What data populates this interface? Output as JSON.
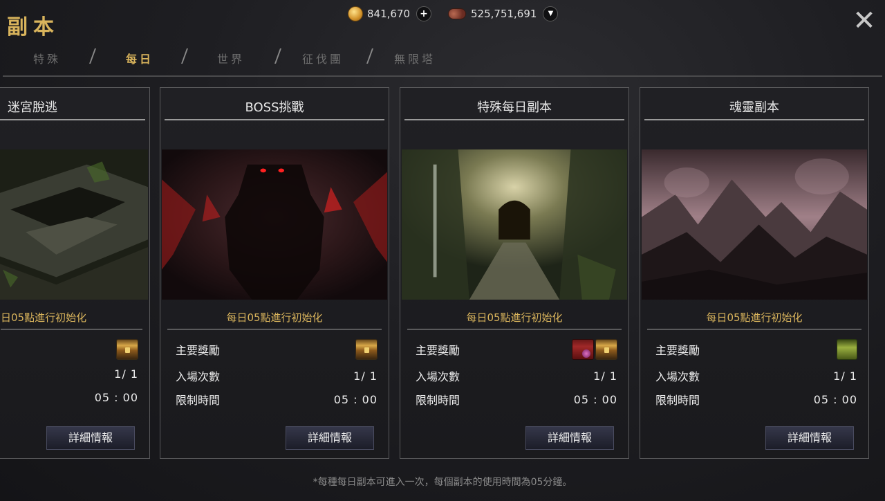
{
  "header": {
    "title": "副本",
    "gold_amount": "841,670",
    "gem_amount": "525,751,691",
    "add_symbol": "+",
    "dropdown_symbol": "▼",
    "close_symbol": "✕"
  },
  "tabs": [
    {
      "label": "特殊",
      "active": false
    },
    {
      "label": "每日",
      "active": true
    },
    {
      "label": "世界",
      "active": false
    },
    {
      "label": "征伐團",
      "active": false
    },
    {
      "label": "無限塔",
      "active": false
    }
  ],
  "cards": [
    {
      "title": "迷宮脫逃",
      "reset": "日05點進行初始化",
      "reward_label": "",
      "entry_label": "",
      "entry_value": "1/ 1",
      "time_label": "",
      "time_value": "05 : 00",
      "details_label": "詳細情報",
      "reward_icons": [
        "treasure-chest-icon"
      ]
    },
    {
      "title": "BOSS挑戰",
      "reset": "每日05點進行初始化",
      "reward_label": "主要獎勵",
      "entry_label": "入場次數",
      "entry_value": "1/ 1",
      "time_label": "限制時間",
      "time_value": "05 : 00",
      "details_label": "詳細情報",
      "reward_icons": [
        "treasure-chest-icon"
      ]
    },
    {
      "title": "特殊每日副本",
      "reset": "每日05點進行初始化",
      "reward_label": "主要獎勵",
      "entry_label": "入場次數",
      "entry_value": "1/ 1",
      "time_label": "限制時間",
      "time_value": "05 : 00",
      "details_label": "詳細情報",
      "reward_icons": [
        "red-box-icon",
        "treasure-chest-icon"
      ]
    },
    {
      "title": "魂靈副本",
      "reset": "每日05點進行初始化",
      "reward_label": "主要獎勵",
      "entry_label": "入場次數",
      "entry_value": "1/ 1",
      "time_label": "限制時間",
      "time_value": "05 : 00",
      "details_label": "詳細情報",
      "reward_icons": [
        "green-chest-icon"
      ]
    }
  ],
  "footer_note": "*每種每日副本可進入一次，每個副本的使用時間為05分鐘。",
  "colors": {
    "accent_gold": "#d9b45c",
    "tab_inactive": "#6e6e6e",
    "card_border": "#5a5a5c"
  }
}
